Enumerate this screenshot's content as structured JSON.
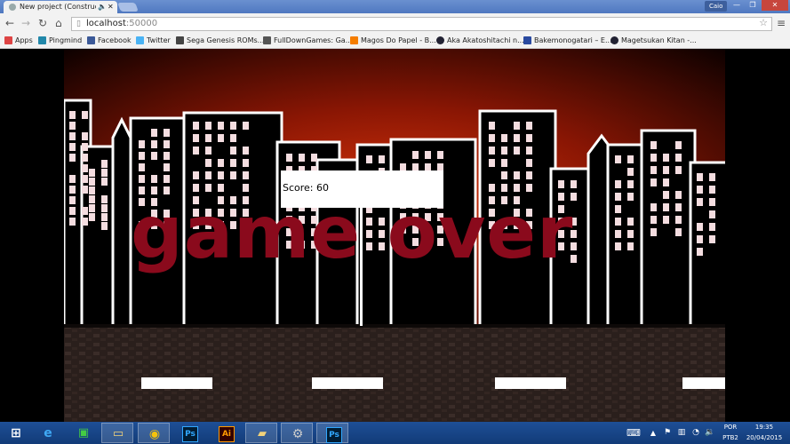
{
  "browser": {
    "tab_title": "New project (Construct",
    "tab_sound_icon": "speaker-icon",
    "tab_close": "✕",
    "user": "Caio",
    "window_min": "—",
    "window_max": "❐",
    "window_close": "✕",
    "url_host": "localhost",
    "url_port": ":50000",
    "bookmarks": [
      {
        "label": "Apps",
        "icon_color": "#d44"
      },
      {
        "label": "Pingmind",
        "icon_color": "#28a"
      },
      {
        "label": "Facebook",
        "icon_color": "#3b5998"
      },
      {
        "label": "Twitter",
        "icon_color": "#4ab3f4"
      },
      {
        "label": "Sega Genesis ROMs...",
        "icon_color": "#444"
      },
      {
        "label": "FullDownGames: Ga...",
        "icon_color": "#555"
      },
      {
        "label": "Magos Do Papel - B...",
        "icon_color": "#f57d00"
      },
      {
        "label": "Aka Akatoshitachi n...",
        "icon_color": "#223"
      },
      {
        "label": "Bakemonogatari – E...",
        "icon_color": "#2a4aa0"
      },
      {
        "label": "Magetsukan Kitan -...",
        "icon_color": "#223"
      }
    ]
  },
  "game": {
    "score_text": "Score: 60",
    "game_over_text": "game over",
    "colors": {
      "sky_top": "#0a0000",
      "sky_glow": "#c42a0a",
      "game_over": "#8a0a1c",
      "road": "#2a1f1c"
    }
  },
  "taskbar": {
    "apps": [
      {
        "name": "windows-start",
        "glyph": "⊞"
      },
      {
        "name": "internet-explorer",
        "glyph": "e"
      },
      {
        "name": "store",
        "glyph": "▣"
      },
      {
        "name": "file-explorer",
        "glyph": "▭"
      },
      {
        "name": "chrome",
        "glyph": "◉"
      },
      {
        "name": "photoshop",
        "glyph": "Ps"
      },
      {
        "name": "illustrator",
        "glyph": "Ai"
      },
      {
        "name": "folder",
        "glyph": "▰"
      },
      {
        "name": "settings",
        "glyph": "⚙"
      },
      {
        "name": "photoshop-2",
        "glyph": "Ps"
      }
    ],
    "language": "POR",
    "layout": "PTB2",
    "time": "19:35",
    "date": "20/04/2015"
  }
}
